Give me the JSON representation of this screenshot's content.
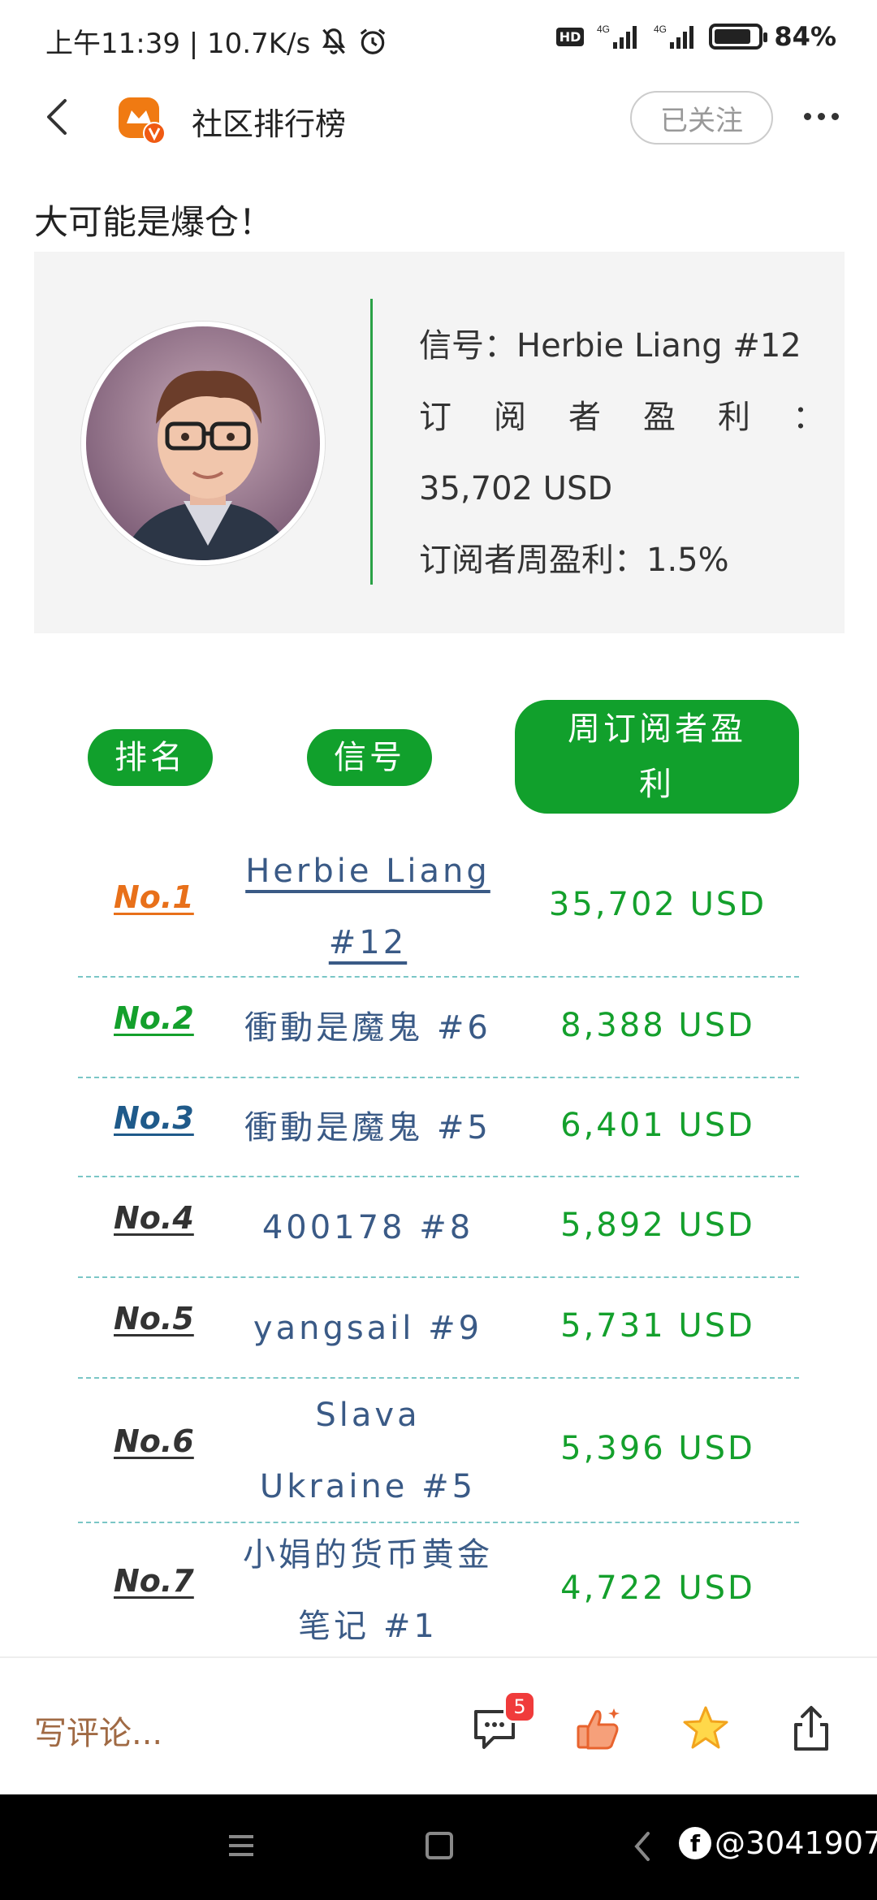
{
  "status_bar": {
    "time_speed": "上午11:39 | 10.7K/s",
    "battery_percent": "84%",
    "network_1": "4G",
    "network_2": "4G",
    "hd": "HD",
    "battery_level": 0.84
  },
  "header": {
    "title": "社区排行榜",
    "follow_label": "已关注"
  },
  "article": {
    "heading": "大可能是爆仓！",
    "signal_line": "信号：Herbie Liang #12",
    "subscriber_profit_label_chars": [
      "订",
      "阅",
      "者",
      "盈",
      "利",
      "："
    ],
    "subscriber_profit_value": "35,702 USD",
    "weekly_profit_line": "订阅者周盈利：1.5%"
  },
  "table": {
    "headers": {
      "rank": "排名",
      "signal": "信号",
      "profit_line1": "周订阅者盈",
      "profit_line2": "利"
    },
    "rows": [
      {
        "rank": "No.1",
        "signal_lines": [
          "Herbie Liang",
          "#12"
        ],
        "profit": "35,702 USD",
        "rank_color": "#e8701a"
      },
      {
        "rank": "No.2",
        "signal_lines": [
          "衝動是魔鬼 #6"
        ],
        "profit": "8,388 USD",
        "rank_color": "#14a02c"
      },
      {
        "rank": "No.3",
        "signal_lines": [
          "衝動是魔鬼 #5"
        ],
        "profit": "6,401 USD",
        "rank_color": "#1f5a8a"
      },
      {
        "rank": "No.4",
        "signal_lines": [
          "400178 #8"
        ],
        "profit": "5,892 USD",
        "rank_color": "#333333"
      },
      {
        "rank": "No.5",
        "signal_lines": [
          "yangsail #9"
        ],
        "profit": "5,731 USD",
        "rank_color": "#333333"
      },
      {
        "rank": "No.6",
        "signal_lines": [
          "Slava",
          "Ukraine #5"
        ],
        "profit": "5,396 USD",
        "rank_color": "#333333"
      },
      {
        "rank": "No.7",
        "signal_lines": [
          "小娟的货币黄金",
          "笔记 #1"
        ],
        "profit": "4,722 USD",
        "rank_color": "#333333"
      }
    ]
  },
  "bottom_bar": {
    "comment_placeholder": "写评论...",
    "comment_count": "5",
    "icons": [
      "comment-icon",
      "like-icon",
      "star-icon",
      "share-icon"
    ]
  },
  "watermark": {
    "text": "@3041907"
  },
  "colors": {
    "accent_green": "#11a02c",
    "signal_blue": "#3a5a86",
    "divider_green": "#2aa146"
  }
}
